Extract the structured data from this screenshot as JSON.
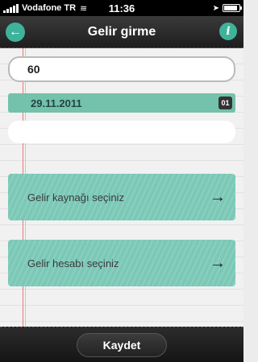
{
  "status_bar": {
    "carrier": "Vodafone TR",
    "time": "11:36",
    "icons": [
      "signal-icon",
      "wifi-icon",
      "location-icon",
      "battery-icon"
    ],
    "battery_level": 0.9
  },
  "nav": {
    "title": "Gelir girme",
    "back_icon": "arrow-left-icon",
    "info_icon": "info-icon"
  },
  "form": {
    "amount_value": "60",
    "date_value": "29.11.2011",
    "calendar_icon_text": "01",
    "note_value": "",
    "source_label": "Gelir kaynağı seçiniz",
    "account_label": "Gelir hesabı seçiniz"
  },
  "footer": {
    "save_label": "Kaydet"
  },
  "colors": {
    "accent": "#3fb29a",
    "button_bg": "#7bc8b6",
    "date_bg": "#74c1ac",
    "bar_dark": "#1e1e1e"
  }
}
